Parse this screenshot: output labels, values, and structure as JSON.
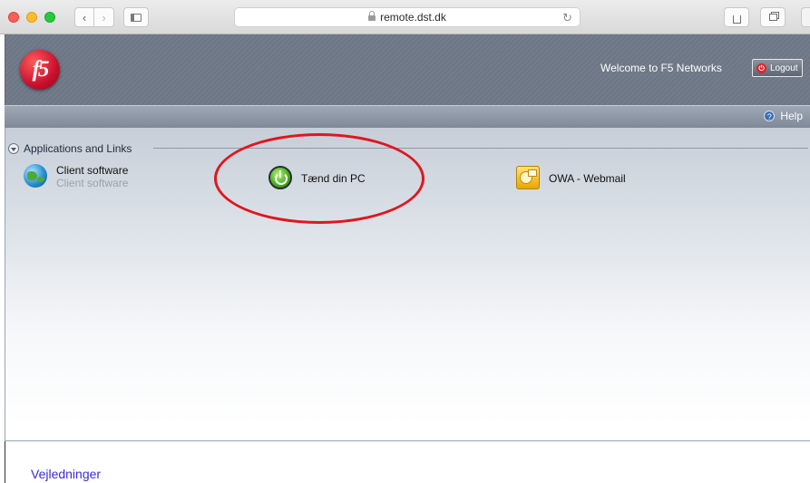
{
  "browser": {
    "url": "remote.dst.dk",
    "back_glyph": "‹",
    "forward_glyph": "›",
    "reload_glyph": "↻"
  },
  "header": {
    "logo_text": "f5",
    "welcome_text": "Welcome to F5 Networks",
    "logout_label": "Logout",
    "logout_icon_glyph": "⏻"
  },
  "helpbar": {
    "help_label": "Help",
    "help_icon_glyph": "?"
  },
  "section": {
    "title": "Applications and Links"
  },
  "apps": {
    "client": {
      "title": "Client software",
      "subtitle": "Client software",
      "icon": "globe-icon"
    },
    "taend": {
      "title": "Tænd din PC",
      "icon": "power-icon"
    },
    "owa": {
      "title": "OWA - Webmail",
      "icon": "outlook-icon"
    }
  },
  "footer": {
    "link_label": "Vejledninger"
  },
  "colors": {
    "annotation": "#e0161f",
    "header_bg": "#6c7684",
    "link": "#3a2ad6"
  }
}
